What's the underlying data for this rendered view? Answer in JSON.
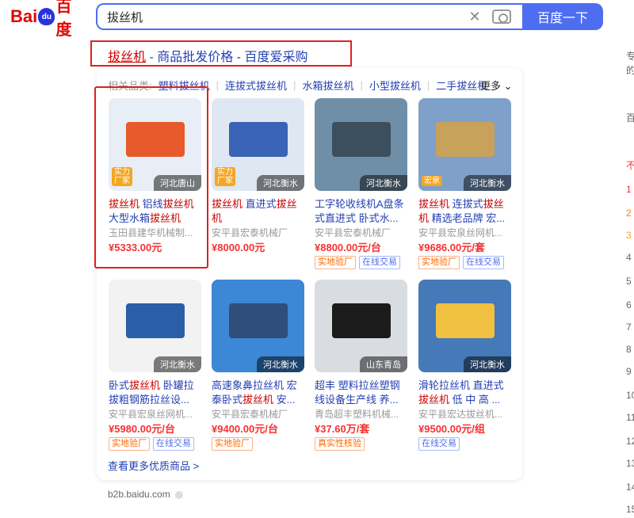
{
  "logo": {
    "text_bai": "Bai",
    "text_du": "du",
    "text_baidu": "百度"
  },
  "search": {
    "query": "拔丝机",
    "button_label": "百度一下"
  },
  "result": {
    "title_highlight": "拔丝机",
    "title_rest": " - 商品批发价格 - 百度爱采购",
    "related_label": "相关品类:",
    "related": [
      "塑料拔丝机",
      "连拔式拔丝机",
      "水箱拔丝机",
      "小型拔丝机",
      "二手拔丝机"
    ],
    "more_label": "更多",
    "more_products": "查看更多优质商品 >",
    "domain": "b2b.baidu.com"
  },
  "products": [
    {
      "loc": "河北唐山",
      "tag": "实力\n厂家",
      "name_parts": [
        "拔丝机",
        " 铝线",
        "拔丝机",
        " 大型水箱",
        "拔丝机"
      ],
      "seller": "玉田县建华机械制...",
      "price": "¥5333.00元",
      "badges": []
    },
    {
      "loc": "河北衡水",
      "tag": "实力\n厂家",
      "name_parts": [
        "拔丝机",
        " 直进式",
        "拔丝机",
        "",
        ""
      ],
      "seller": "安平县宏泰机械厂",
      "price": "¥8000.00元",
      "badges": []
    },
    {
      "loc": "河北衡水",
      "tag": "",
      "name_parts": [
        "",
        "工字轮收线机A盘条式直进式 卧式水...",
        "",
        "",
        ""
      ],
      "seller": "安平县宏泰机械厂",
      "price": "¥8800.00元/台",
      "badges": [
        "实地验厂",
        "在线交易"
      ]
    },
    {
      "loc": "河北衡水",
      "tag": "宏泉",
      "name_parts": [
        "拔丝机",
        " 连拔式",
        "拔丝机",
        " 精选老品牌 宏...",
        ""
      ],
      "seller": "安平县宏泉丝网机...",
      "price": "¥9686.00元/套",
      "badges": [
        "实地验厂",
        "在线交易"
      ]
    },
    {
      "loc": "河北衡水",
      "tag": "",
      "name_parts": [
        "",
        "卧式",
        "拔丝机",
        " 卧罐拉拔粗钢筋拉丝设...",
        ""
      ],
      "seller": "安平县宏泉丝网机...",
      "price": "¥5980.00元/台",
      "badges": [
        "实地验厂",
        "在线交易"
      ]
    },
    {
      "loc": "河北衡水",
      "tag": "",
      "name_parts": [
        "",
        "高速象鼻拉丝机 宏泰卧式",
        "拔丝机",
        " 安...",
        ""
      ],
      "seller": "安平县宏泰机械厂",
      "price": "¥9400.00元/台",
      "badges": [
        "实地验厂"
      ]
    },
    {
      "loc": "山东青岛",
      "tag": "",
      "name_parts": [
        "",
        "超丰 塑料拉丝塑钢线设备生产线 养...",
        "",
        "",
        ""
      ],
      "seller": "青岛超丰塑料机械...",
      "price": "¥37.60万/套",
      "badges": [
        "真实性核验"
      ]
    },
    {
      "loc": "河北衡水",
      "tag": "",
      "name_parts": [
        "",
        "滑轮拉丝机 直进式",
        "拔丝机",
        " 低 中 高 ...",
        ""
      ],
      "seller": "安平县宏达拔丝机...",
      "price": "¥9500.00元/组",
      "badges": [
        "在线交易"
      ]
    }
  ],
  "right_col": [
    "专",
    "的",
    "百",
    "不",
    "1",
    "2",
    "3",
    "4",
    "5",
    "6",
    "7",
    "8",
    "9",
    "10",
    "11",
    "12",
    "13",
    "14",
    "15"
  ]
}
